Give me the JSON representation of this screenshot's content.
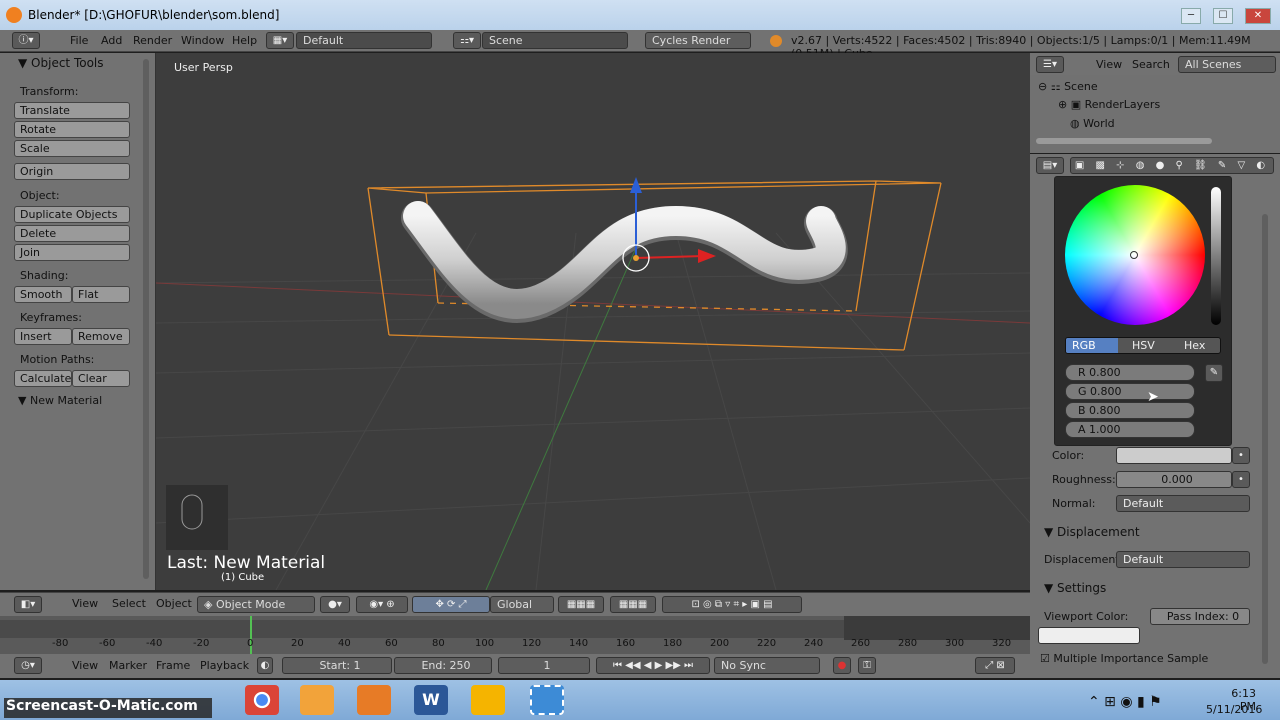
{
  "window": {
    "title": "Blender* [D:\\GHOFUR\\blender\\som.blend]",
    "minimize": "─",
    "maximize": "☐",
    "close": "✕"
  },
  "menubar": {
    "menus": [
      "File",
      "Add",
      "Render",
      "Window",
      "Help"
    ],
    "layout": "Default",
    "scene": "Scene",
    "engine": "Cycles Render",
    "stats": "v2.67 | Verts:4522 | Faces:4502 | Tris:8940 | Objects:1/5 | Lamps:0/1 | Mem:11.49M (0.51M) | Cube"
  },
  "toolshelf": {
    "title": "Object Tools",
    "transform_label": "Transform:",
    "translate": "Translate",
    "rotate": "Rotate",
    "scale": "Scale",
    "origin": "Origin",
    "object_label": "Object:",
    "duplicate": "Duplicate Objects",
    "delete": "Delete",
    "join": "Join",
    "shading_label": "Shading:",
    "smooth": "Smooth",
    "flat": "Flat",
    "keyframes_label": "Keyframes:",
    "insert": "Insert",
    "remove": "Remove",
    "motion_label": "Motion Paths:",
    "calculate": "Calculate",
    "clear": "Clear",
    "new_material": "New Material"
  },
  "viewport": {
    "view_name": "User Persp",
    "last_op": "Last: New Material",
    "object_name": "(1) Cube"
  },
  "vpheader": {
    "view": "View",
    "select": "Select",
    "object": "Object",
    "mode": "Object Mode",
    "orientation": "Global"
  },
  "timeline": {
    "ticks": [
      "-80",
      "-60",
      "-40",
      "-20",
      "0",
      "20",
      "40",
      "60",
      "80",
      "100",
      "120",
      "140",
      "160",
      "180",
      "200",
      "220",
      "240",
      "260",
      "280",
      "300",
      "320"
    ],
    "view": "View",
    "marker": "Marker",
    "frame": "Frame",
    "playback": "Playback",
    "start": "Start: 1",
    "end": "End: 250",
    "current": "1",
    "sync": "No Sync"
  },
  "outliner": {
    "view": "View",
    "search": "Search",
    "filter": "All Scenes",
    "scene": "Scene",
    "renderlayers": "RenderLayers",
    "world": "World"
  },
  "colorpicker": {
    "tabs": [
      "RGB",
      "HSV",
      "Hex"
    ],
    "r": "R 0.800",
    "g": "G 0.800",
    "b": "B 0.800",
    "a": "A 1.000"
  },
  "props": {
    "color_label": "Color:",
    "roughness_label": "Roughness:",
    "roughness": "0.000",
    "normal_label": "Normal:",
    "normal": "Default",
    "displacement_header": "Displacement",
    "displacement_label": "Displacement:",
    "displacement": "Default",
    "settings_header": "Settings",
    "viewport_color": "Viewport Color:",
    "pass_index": "Pass Index: 0",
    "multi_importance": "Multiple Importance Sample"
  },
  "taskbar": {
    "watermark": "Screencast-O-Matic.com",
    "time": "6:13 PM",
    "date": "5/11/2016"
  }
}
